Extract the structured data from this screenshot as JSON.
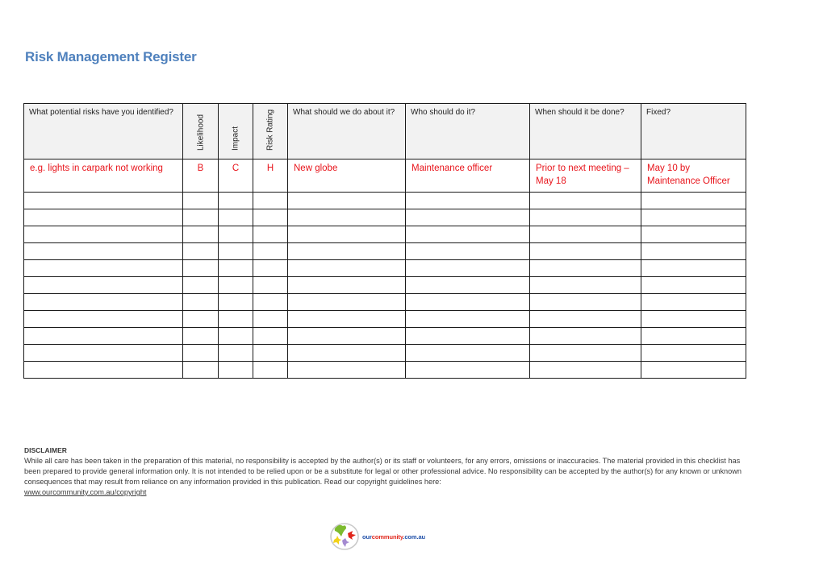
{
  "document": {
    "title": "Risk Management Register"
  },
  "table": {
    "headers": [
      {
        "label": "What potential risks have you identified?",
        "orientation": "horizontal"
      },
      {
        "label": "Likelihood",
        "orientation": "vertical"
      },
      {
        "label": "Impact",
        "orientation": "vertical"
      },
      {
        "label": "Risk Rating",
        "orientation": "vertical"
      },
      {
        "label": "What should we do about it?",
        "orientation": "horizontal"
      },
      {
        "label": "Who should do it?",
        "orientation": "horizontal"
      },
      {
        "label": "When should it be done?",
        "orientation": "horizontal"
      },
      {
        "label": "Fixed?",
        "orientation": "horizontal"
      }
    ],
    "example_row": {
      "risk": "e.g. lights in carpark not working",
      "likelihood": "B",
      "impact": "C",
      "risk_rating": "H",
      "action": "New globe",
      "who": "Maintenance officer",
      "when": "Prior to next meeting – May 18",
      "fixed": "May 10 by Maintenance Officer"
    },
    "empty_row_count": 11,
    "example_text_color": "#e8141b",
    "header_background": "#f2f2f2"
  },
  "disclaimer": {
    "heading": "DISCLAIMER",
    "body": "While all care has been taken in the preparation of this material, no responsibility is accepted by the author(s) or its staff or volunteers, for any errors, omissions or inaccuracies. The material provided in this checklist has been prepared to provide general information only. It is not intended to be relied upon or be a substitute for legal or other professional advice. No responsibility can be accepted by the author(s) for any known or unknown consequences that may result from reliance on any information provided in this publication. Read our copyright guidelines here:",
    "link_text": "www.ourcommunity.com.au/copyright"
  },
  "footer": {
    "logo_text_part1": "our",
    "logo_text_part2": "community",
    "logo_text_part3": ".com.au",
    "logo_colors": {
      "our": "#1f4fa8",
      "community": "#e0261b",
      "domain": "#1f4fa8"
    }
  },
  "theme": {
    "title_color": "#4f81bd"
  }
}
